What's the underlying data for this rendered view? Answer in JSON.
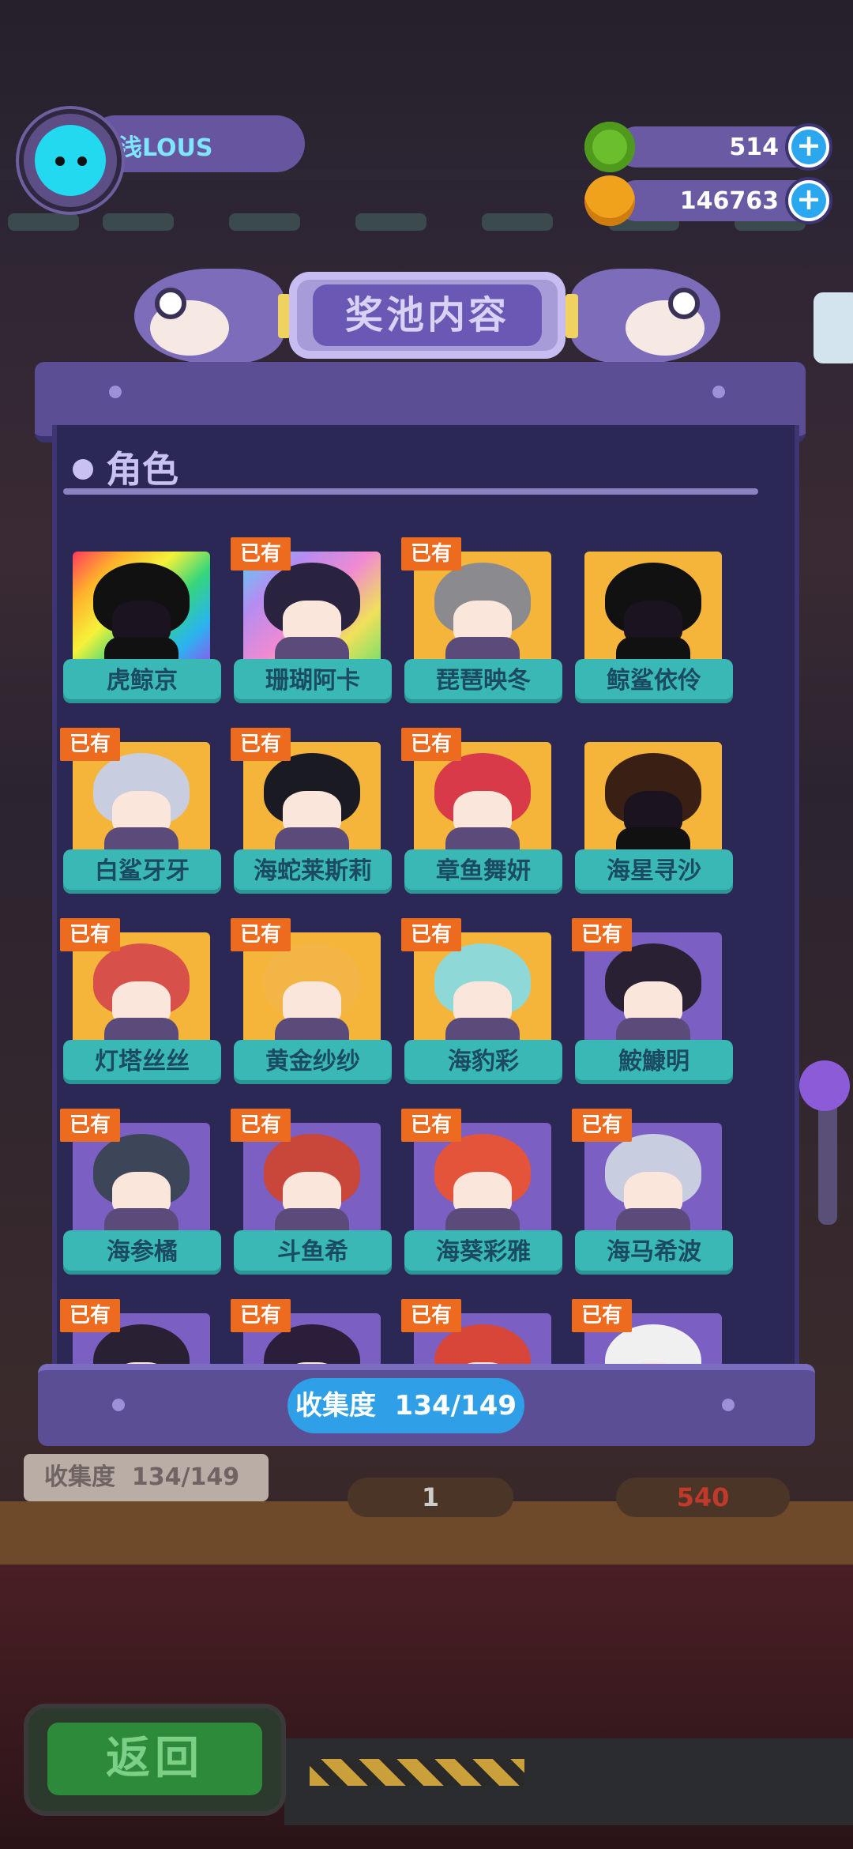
{
  "player": {
    "name": "浅LOUS",
    "avatar_icon": "cat-avatar-icon"
  },
  "currencies": [
    {
      "name": "green-token",
      "value": "514",
      "color": "#6bbf2c",
      "icon": "green-coin-icon"
    },
    {
      "name": "planet-coin",
      "value": "146763",
      "color": "#f0a21c",
      "icon": "gold-planet-icon"
    }
  ],
  "title": "奖池内容",
  "section": {
    "title": "角色"
  },
  "owned_label": "已有",
  "characters": [
    {
      "name": "虎鲸京",
      "owned": false,
      "frame": "rainbow",
      "hair": "#111111"
    },
    {
      "name": "珊瑚阿卡",
      "owned": true,
      "frame": "rainbow2",
      "hair": "#2a2340"
    },
    {
      "name": "琵琶映冬",
      "owned": true,
      "frame": "gold",
      "hair": "#8a8a8f"
    },
    {
      "name": "鲸鲨依伶",
      "owned": false,
      "frame": "gold",
      "hair": "#111111"
    },
    {
      "name": "白鲨牙牙",
      "owned": true,
      "frame": "gold",
      "hair": "#c9cde0"
    },
    {
      "name": "海蛇莱斯莉",
      "owned": true,
      "frame": "gold",
      "hair": "#1a1a22"
    },
    {
      "name": "章鱼舞妍",
      "owned": true,
      "frame": "gold",
      "hair": "#d83a4a"
    },
    {
      "name": "海星寻沙",
      "owned": false,
      "frame": "gold",
      "hair": "#3a2014"
    },
    {
      "name": "灯塔丝丝",
      "owned": true,
      "frame": "gold",
      "hair": "#d8504a"
    },
    {
      "name": "黄金纱纱",
      "owned": true,
      "frame": "gold",
      "hair": "#f3b545"
    },
    {
      "name": "海豹彩",
      "owned": true,
      "frame": "gold",
      "hair": "#8fd8d8"
    },
    {
      "name": "鮟鱇明",
      "owned": true,
      "frame": "purple",
      "hair": "#2a2033"
    },
    {
      "name": "海参橘",
      "owned": true,
      "frame": "purple",
      "hair": "#3c4658"
    },
    {
      "name": "斗鱼希",
      "owned": true,
      "frame": "purple",
      "hair": "#c8463a"
    },
    {
      "name": "海葵彩雅",
      "owned": true,
      "frame": "purple",
      "hair": "#e4543a"
    },
    {
      "name": "海马希波",
      "owned": true,
      "frame": "purple",
      "hair": "#c9cde0"
    },
    {
      "name": "",
      "owned": true,
      "frame": "purple",
      "hair": "#2a2033"
    },
    {
      "name": "",
      "owned": true,
      "frame": "purple",
      "hair": "#2a1e3a"
    },
    {
      "name": "",
      "owned": true,
      "frame": "purple",
      "hair": "#d8463a"
    },
    {
      "name": "",
      "owned": true,
      "frame": "purple",
      "hair": "#f0f0f0"
    }
  ],
  "collection": {
    "label": "收集度",
    "progress": "134/149"
  },
  "background": {
    "collection_label": "收集度",
    "collection_progress": "134/149",
    "count_1": "1",
    "count_2": "540"
  },
  "return_button": "返回"
}
